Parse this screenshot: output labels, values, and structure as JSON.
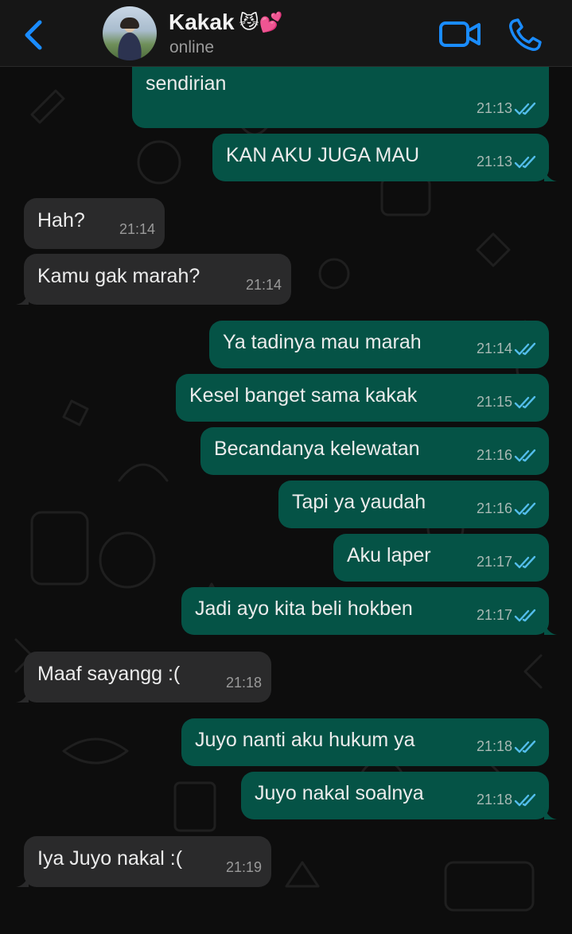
{
  "header": {
    "contact_name": "Kakak",
    "contact_emoji": "😼💕",
    "status": "online"
  },
  "colors": {
    "outgoing_bubble": "#055346",
    "incoming_bubble": "#2a2a2b",
    "accent_blue": "#1a8cff",
    "read_tick": "#53bdeb"
  },
  "icons": {
    "back": "chevron-left-icon",
    "video": "video-camera-icon",
    "call": "phone-icon",
    "read": "double-check-icon"
  },
  "messages": [
    {
      "dir": "out",
      "text": "Kok bisa kakak makan hokben\nsendirian",
      "time": "21:13",
      "read": true
    },
    {
      "dir": "out",
      "text": "KAN AKU JUGA MAU",
      "time": "21:13",
      "read": true
    },
    {
      "dir": "in",
      "text": "Hah?",
      "time": "21:14"
    },
    {
      "dir": "in",
      "text": "Kamu gak marah?",
      "time": "21:14"
    },
    {
      "dir": "out",
      "text": "Ya tadinya mau marah",
      "time": "21:14",
      "read": true
    },
    {
      "dir": "out",
      "text": "Kesel banget sama kakak",
      "time": "21:15",
      "read": true
    },
    {
      "dir": "out",
      "text": "Becandanya kelewatan",
      "time": "21:16",
      "read": true
    },
    {
      "dir": "out",
      "text": "Tapi ya yaudah",
      "time": "21:16",
      "read": true
    },
    {
      "dir": "out",
      "text": "Aku laper",
      "time": "21:17",
      "read": true
    },
    {
      "dir": "out",
      "text": "Jadi ayo kita beli hokben",
      "time": "21:17",
      "read": true
    },
    {
      "dir": "in",
      "text": "Maaf sayangg :(",
      "time": "21:18"
    },
    {
      "dir": "out",
      "text": "Juyo nanti aku hukum ya",
      "time": "21:18",
      "read": true
    },
    {
      "dir": "out",
      "text": "Juyo nakal soalnya",
      "time": "21:18",
      "read": true
    },
    {
      "dir": "in",
      "text": "Iya Juyo nakal :(",
      "time": "21:19"
    }
  ]
}
